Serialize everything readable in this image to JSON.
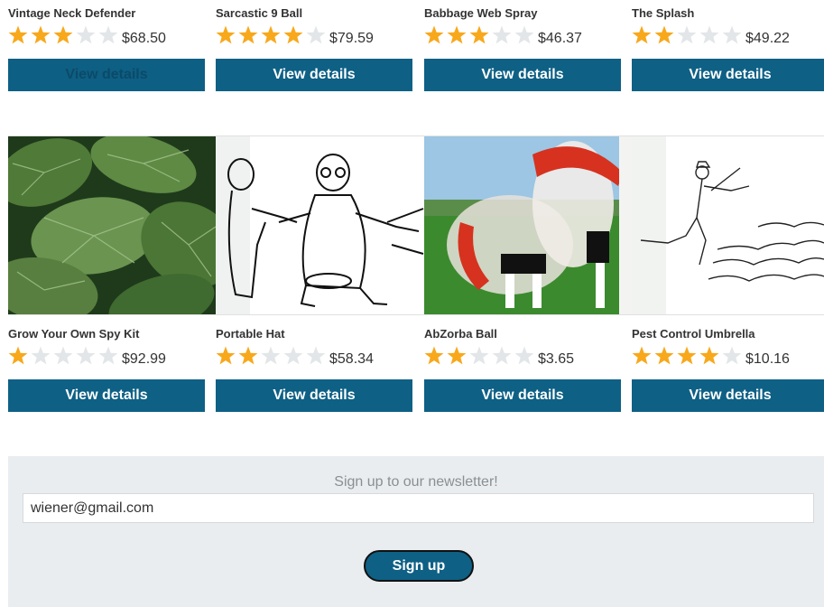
{
  "products_top": [
    {
      "name": "Vintage Neck Defender",
      "rating": 3,
      "price": "$68.50",
      "button": "View details"
    },
    {
      "name": "Sarcastic 9 Ball",
      "rating": 4,
      "price": "$79.59",
      "button": "View details"
    },
    {
      "name": "Babbage Web Spray",
      "rating": 3,
      "price": "$46.37",
      "button": "View details"
    },
    {
      "name": "The Splash",
      "rating": 2,
      "price": "$49.22",
      "button": "View details"
    }
  ],
  "products_bottom": [
    {
      "name": "Grow Your Own Spy Kit",
      "rating": 1,
      "price": "$92.99",
      "button": "View details",
      "image": "leaves-photo"
    },
    {
      "name": "Portable Hat",
      "rating": 2,
      "price": "$58.34",
      "button": "View details",
      "image": "cartoon-people-drawing"
    },
    {
      "name": "AbZorba Ball",
      "rating": 2,
      "price": "$3.65",
      "button": "View details",
      "image": "bubble-football-photo"
    },
    {
      "name": "Pest Control Umbrella",
      "rating": 4,
      "price": "$10.16",
      "button": "View details",
      "image": "cartoon-rats-drawing"
    }
  ],
  "rating_max": 5,
  "colors": {
    "star_filled": "#f8a81b",
    "star_empty": "#e3e6e8",
    "button": "#0e6085",
    "newsletter_bg": "#e9edef"
  },
  "newsletter": {
    "heading": "Sign up to our newsletter!",
    "email_value": "wiener@gmail.com",
    "button": "Sign up"
  }
}
